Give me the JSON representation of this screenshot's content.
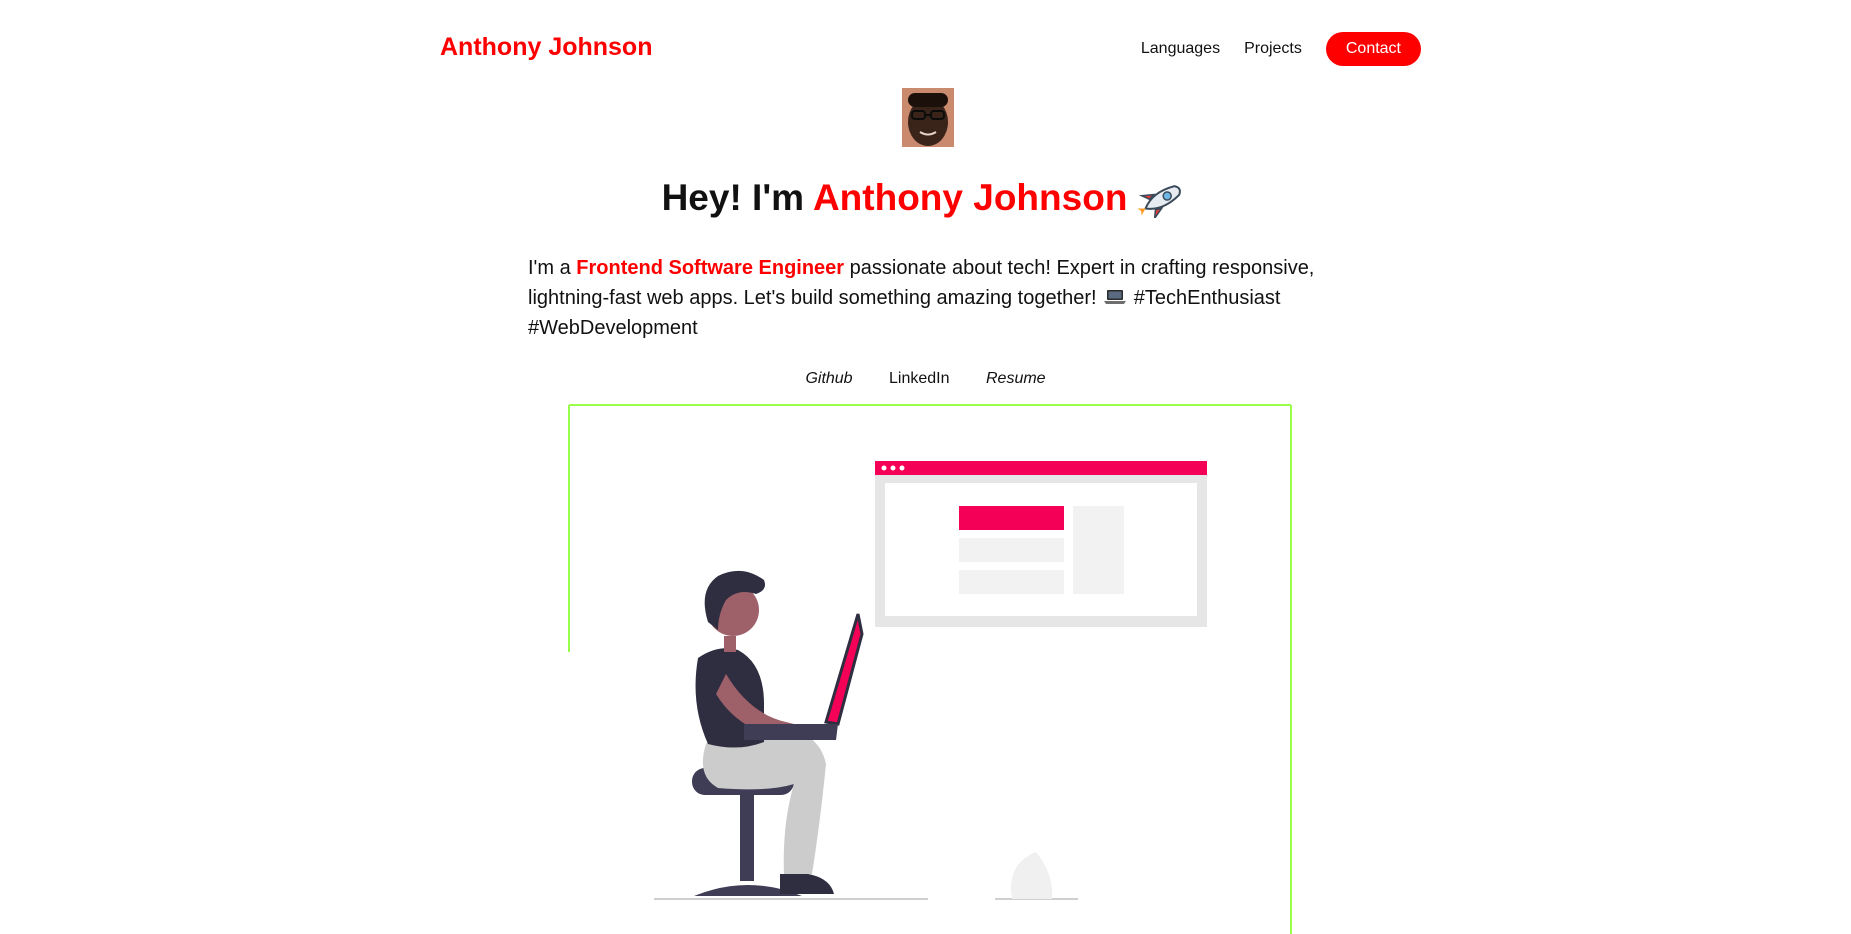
{
  "header": {
    "brand": "Anthony Johnson",
    "nav": {
      "languages": "Languages",
      "projects": "Projects",
      "contact": "Contact"
    }
  },
  "hero": {
    "title_prefix": "Hey! I'm ",
    "title_name": "Anthony Johnson",
    "title_emoji": "rocket-icon"
  },
  "intro": {
    "part1": "I'm a ",
    "role": "Frontend Software Engineer",
    "part2": " passionate about tech! Expert in crafting responsive, lightning-fast web apps. Let's build something amazing together! ",
    "part3": " #TechEnthusiast #WebDevelopment",
    "emoji": "laptop-icon"
  },
  "socials": {
    "github": "Github",
    "linkedin": "LinkedIn",
    "resume": "Resume"
  },
  "colors": {
    "accent": "#ff0000",
    "illustration_accent": "#f50057",
    "frame_border": "#9aff4a"
  }
}
